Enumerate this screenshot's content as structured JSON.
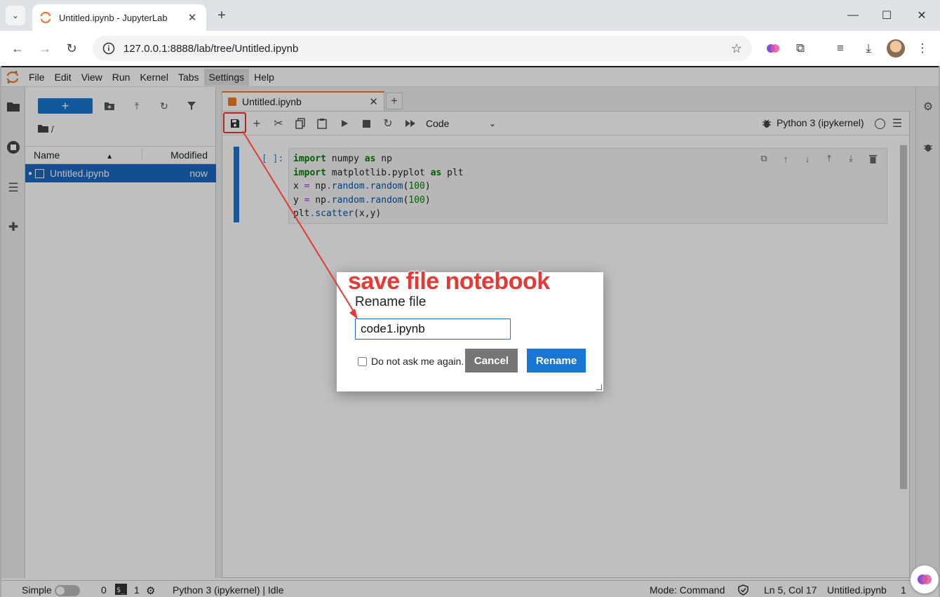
{
  "browser": {
    "tab_title": "Untitled.ipynb - JupyterLab",
    "url": "127.0.0.1:8888/lab/tree/Untitled.ipynb"
  },
  "menu": [
    "File",
    "Edit",
    "View",
    "Run",
    "Kernel",
    "Tabs",
    "Settings",
    "Help"
  ],
  "filebrowser": {
    "new_label": "+",
    "path": "/",
    "col_name": "Name",
    "col_modified": "Modified",
    "files": [
      {
        "name": "Untitled.ipynb",
        "modified": "now"
      }
    ]
  },
  "notebook": {
    "tab_title": "Untitled.ipynb",
    "cell_type": "Code",
    "kernel": "Python 3 (ipykernel)",
    "prompt": "[ ]:",
    "code_lines": [
      "import numpy as np",
      "import matplotlib.pyplot as plt",
      "x = np.random.random(100)",
      "y = np.random.random(100)",
      "plt.scatter(x,y)"
    ]
  },
  "dialog": {
    "annotation": "save file notebook",
    "title": "Rename file",
    "input_value": "code1.ipynb",
    "checkbox_label": "Do not ask me again.",
    "cancel_label": "Cancel",
    "rename_label": "Rename"
  },
  "statusbar": {
    "mode_label": "Simple",
    "terminals": "0",
    "kernels": "1",
    "kernel_status": "Python 3 (ipykernel) | Idle",
    "mode": "Mode: Command",
    "cursor": "Ln 5, Col 17",
    "filename": "Untitled.ipynb",
    "right_count": "1"
  },
  "colors": {
    "accent": "#1976d2",
    "annotation": "#e53935",
    "jupyter_orange": "#f37726"
  }
}
